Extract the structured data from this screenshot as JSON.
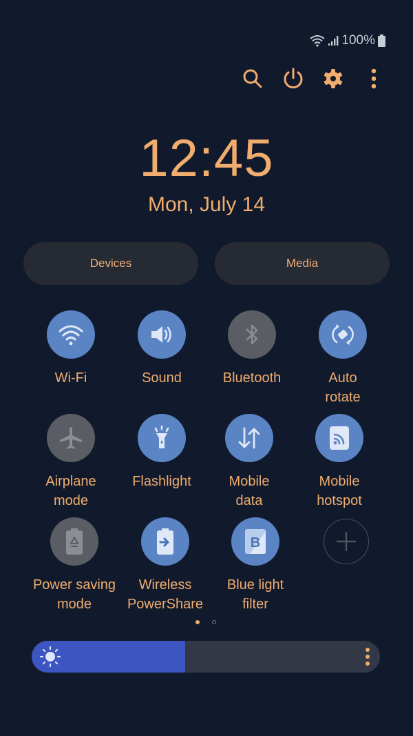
{
  "status_bar": {
    "battery_text": "100%",
    "icons": [
      "wifi-icon",
      "signal-icon",
      "battery-icon"
    ]
  },
  "header": {
    "actions": [
      {
        "name": "search",
        "icon": "search-icon"
      },
      {
        "name": "power",
        "icon": "power-icon"
      },
      {
        "name": "settings",
        "icon": "gear-icon"
      },
      {
        "name": "more-options",
        "icon": "more-vertical-icon"
      }
    ]
  },
  "clock": {
    "time": "12:45",
    "date": "Mon, July 14"
  },
  "pills": {
    "devices": "Devices",
    "media": "Media"
  },
  "tiles": [
    {
      "label": "Wi-Fi",
      "state": "on",
      "icon": "wifi-icon"
    },
    {
      "label": "Sound",
      "state": "on",
      "icon": "sound-icon"
    },
    {
      "label": "Bluetooth",
      "state": "off",
      "icon": "bluetooth-icon"
    },
    {
      "label": "Auto rotate",
      "state": "on",
      "icon": "auto-rotate-icon"
    },
    {
      "label": "Airplane mode",
      "state": "off",
      "icon": "airplane-icon"
    },
    {
      "label": "Flashlight",
      "state": "on",
      "icon": "flashlight-icon"
    },
    {
      "label": "Mobile data",
      "state": "on",
      "icon": "mobile-data-icon"
    },
    {
      "label": "Mobile hotspot",
      "state": "on",
      "icon": "hotspot-icon"
    },
    {
      "label": "Power saving mode",
      "state": "off",
      "icon": "power-saving-icon"
    },
    {
      "label": "Wireless PowerShare",
      "state": "on",
      "icon": "powershare-icon"
    },
    {
      "label": "Blue light filter",
      "state": "on",
      "icon": "blue-light-filter-icon"
    },
    {
      "label": "",
      "state": "add",
      "icon": "plus-icon"
    }
  ],
  "pager": {
    "current_page": 1,
    "total_pages": 2
  },
  "brightness": {
    "level_percent": 44
  },
  "colors": {
    "background": "#111a2c",
    "accent": "#f0ad6e",
    "tile_on": "#5a84c4",
    "tile_off": "#5a5d63",
    "brightness_fill": "#3c55c0"
  }
}
